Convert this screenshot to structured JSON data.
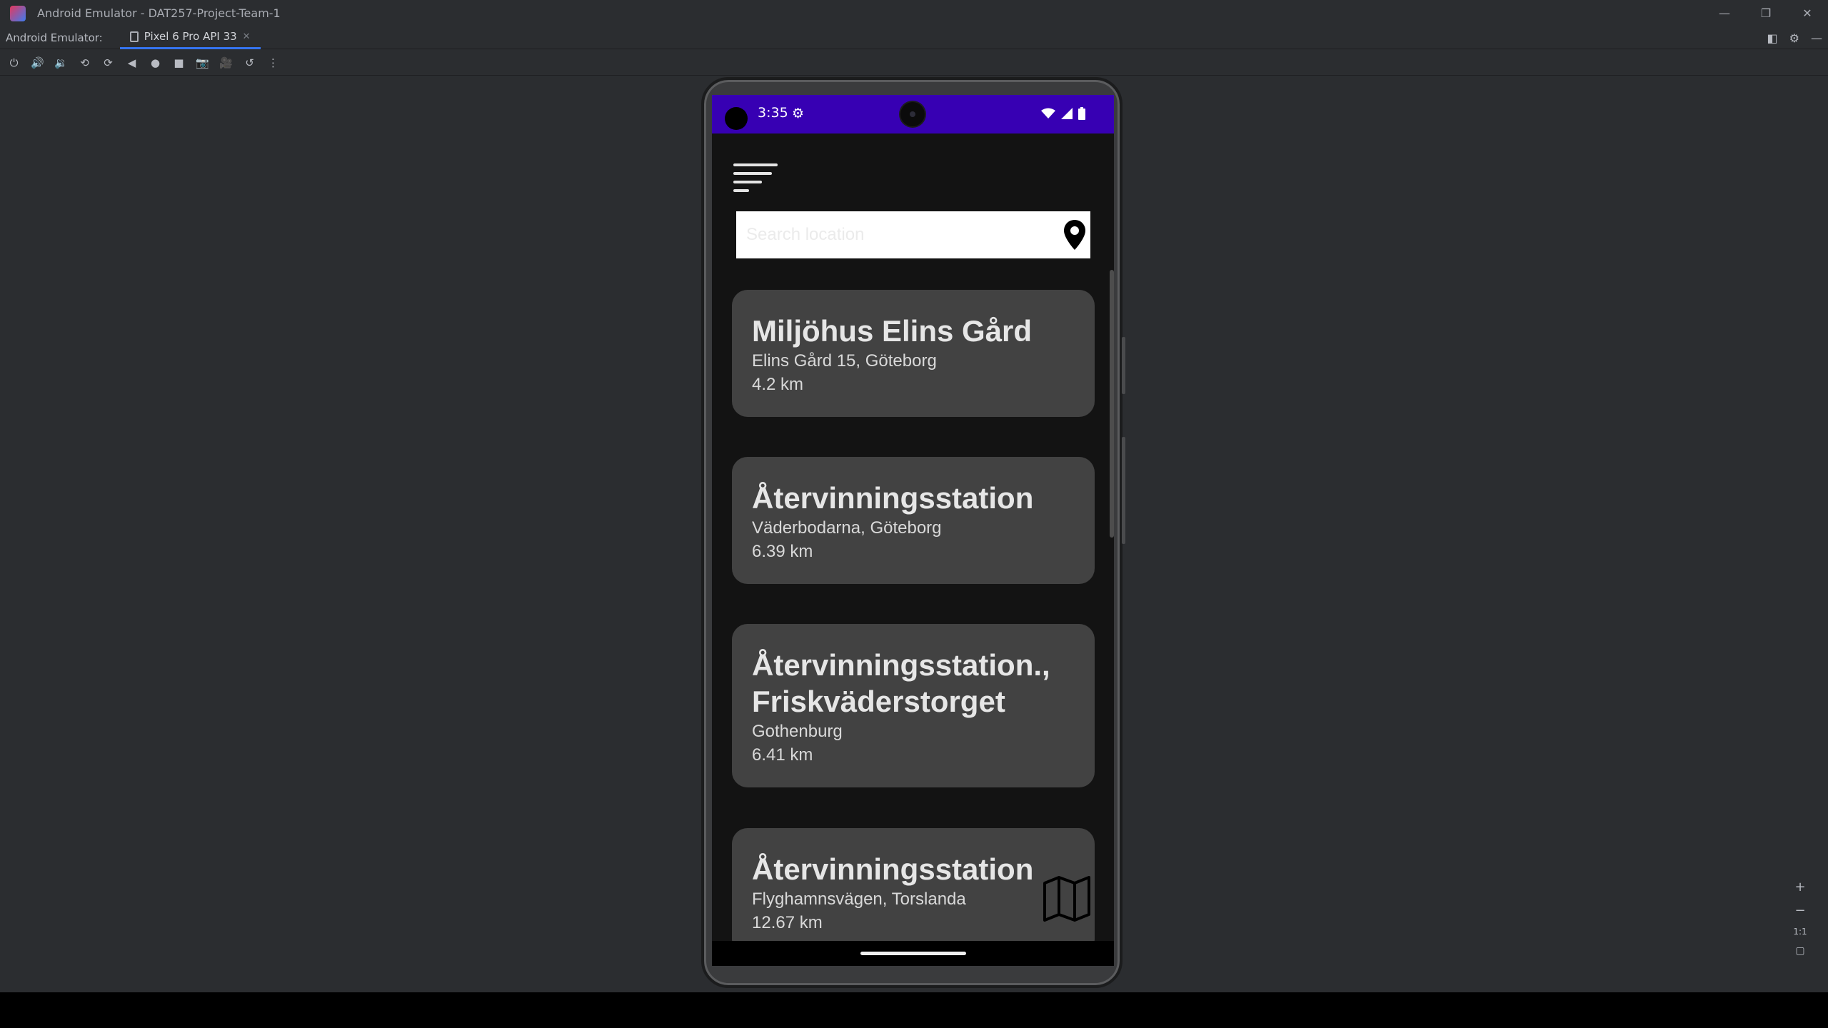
{
  "window": {
    "title": "Android Emulator - DAT257-Project-Team-1",
    "controls": [
      "minimize",
      "restore",
      "close"
    ]
  },
  "tabbar": {
    "label": "Android Emulator:",
    "active_tab": "Pixel 6 Pro API 33"
  },
  "toolbar": {
    "icons": [
      "power-icon",
      "volume-up-icon",
      "volume-down-icon",
      "rotate-left-icon",
      "rotate-right-icon",
      "back-icon",
      "home-icon",
      "overview-icon",
      "screenshot-icon",
      "record-icon",
      "reset-icon",
      "more-icon"
    ]
  },
  "phone": {
    "status": {
      "time": "3:35"
    },
    "search": {
      "placeholder": "Search location"
    },
    "results": [
      {
        "title": "Miljöhus Elins Gård",
        "address": "Elins Gård 15, Göteborg",
        "distance": "4.2 km"
      },
      {
        "title": "Återvinningsstation",
        "address": "Väderbodarna, Göteborg",
        "distance": "6.39 km"
      },
      {
        "title": "Återvinningsstation., Friskväderstorget",
        "address": "Gothenburg",
        "distance": "6.41 km"
      },
      {
        "title": "Återvinningsstation",
        "address": "Flyghamnsvägen, Torslanda",
        "distance": "12.67 km"
      }
    ]
  },
  "zoom": {
    "plus": "+",
    "minus": "−",
    "one_to_one": "1:1"
  }
}
